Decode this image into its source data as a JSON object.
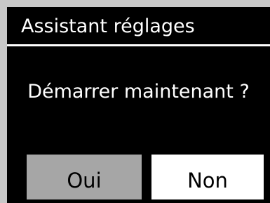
{
  "screen": {
    "title": "Assistant réglages",
    "prompt": "Démarrer maintenant ?"
  },
  "buttons": {
    "yes_label": "Oui",
    "no_label": "Non",
    "selected": "Oui"
  },
  "colors": {
    "background": "#000000",
    "text": "#ffffff",
    "frame": "#c8c8c8",
    "selected_button": "#a6a6a6",
    "unselected_button": "#ffffff"
  }
}
